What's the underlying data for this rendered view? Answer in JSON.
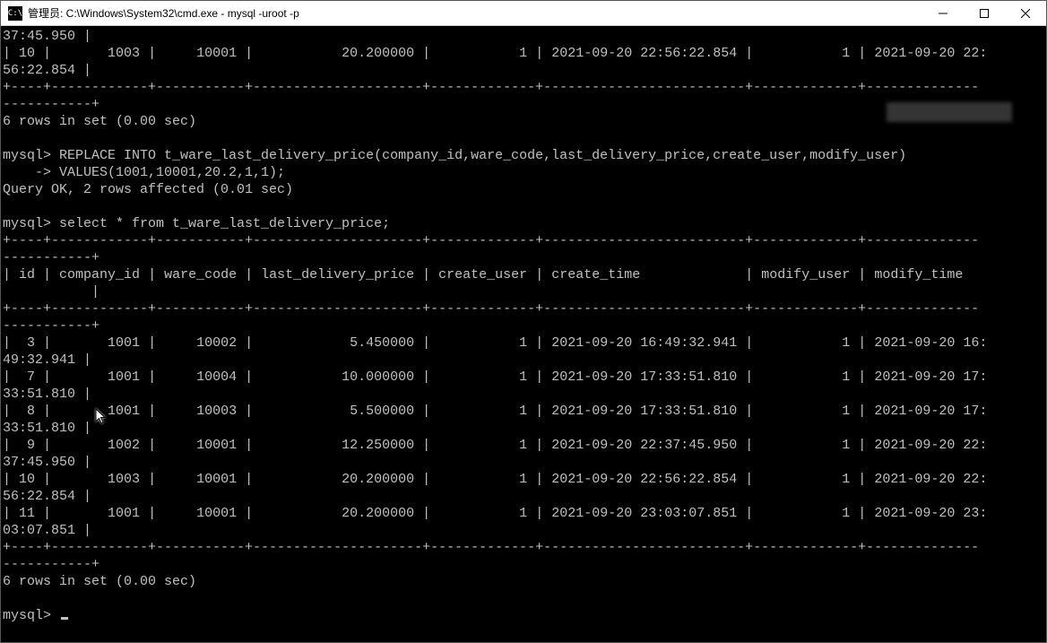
{
  "window": {
    "title": "管理员: C:\\Windows\\System32\\cmd.exe - mysql  -uroot -p",
    "icon_label": "C:\\"
  },
  "top_row": {
    "wrap_time": "37:45.950",
    "id": "10",
    "company_id": "1003",
    "ware_code": "10001",
    "price": "20.200000",
    "create_user": "1",
    "create_time": "2021-09-20 22:56:22.854",
    "modify_user": "1",
    "modify_time": "2021-09-20 22:",
    "wrap_time2": "56:22.854"
  },
  "sep_top": "+----+------------+-----------+---------------------+-------------+-------------------------+-------------+--------------",
  "sep_wrap": "-----------+",
  "rows_in_set_1": "6 rows in set (0.00 sec)",
  "replace_stmt": {
    "line1": "mysql> REPLACE INTO t_ware_last_delivery_price(company_id,ware_code,last_delivery_price,create_user,modify_user)",
    "line2": "    -> VALUES(1001,10001,20.2,1,1);",
    "result": "Query OK, 2 rows affected (0.01 sec)"
  },
  "select_stmt": "mysql> select * from t_ware_last_delivery_price;",
  "headers": {
    "id": "id",
    "company_id": "company_id",
    "ware_code": "ware_code",
    "last_delivery_price": "last_delivery_price",
    "create_user": "create_user",
    "create_time": "create_time",
    "modify_user": "modify_user",
    "modify_time": "modify_time"
  },
  "rows": [
    {
      "id": "3",
      "company_id": "1001",
      "ware_code": "10002",
      "price": "5.450000",
      "create_user": "1",
      "create_time": "2021-09-20 16:49:32.941",
      "modify_user": "1",
      "modify_time": "2021-09-20 16:",
      "wrap": "49:32.941"
    },
    {
      "id": "7",
      "company_id": "1001",
      "ware_code": "10004",
      "price": "10.000000",
      "create_user": "1",
      "create_time": "2021-09-20 17:33:51.810",
      "modify_user": "1",
      "modify_time": "2021-09-20 17:",
      "wrap": "33:51.810"
    },
    {
      "id": "8",
      "company_id": "1001",
      "ware_code": "10003",
      "price": "5.500000",
      "create_user": "1",
      "create_time": "2021-09-20 17:33:51.810",
      "modify_user": "1",
      "modify_time": "2021-09-20 17:",
      "wrap": "33:51.810"
    },
    {
      "id": "9",
      "company_id": "1002",
      "ware_code": "10001",
      "price": "12.250000",
      "create_user": "1",
      "create_time": "2021-09-20 22:37:45.950",
      "modify_user": "1",
      "modify_time": "2021-09-20 22:",
      "wrap": "37:45.950"
    },
    {
      "id": "10",
      "company_id": "1003",
      "ware_code": "10001",
      "price": "20.200000",
      "create_user": "1",
      "create_time": "2021-09-20 22:56:22.854",
      "modify_user": "1",
      "modify_time": "2021-09-20 22:",
      "wrap": "56:22.854"
    },
    {
      "id": "11",
      "company_id": "1001",
      "ware_code": "10001",
      "price": "20.200000",
      "create_user": "1",
      "create_time": "2021-09-20 23:03:07.851",
      "modify_user": "1",
      "modify_time": "2021-09-20 23:",
      "wrap": "03:07.851"
    }
  ],
  "rows_in_set_2": "6 rows in set (0.00 sec)",
  "prompt": "mysql> "
}
